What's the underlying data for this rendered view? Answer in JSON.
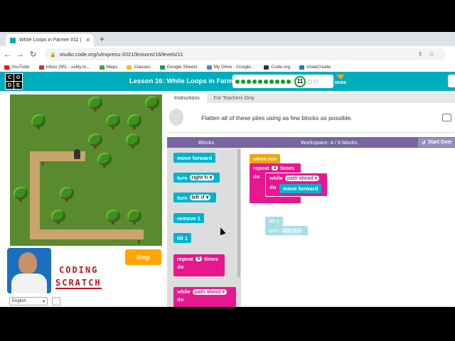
{
  "browser": {
    "tab_title": "While Loops in Farmer #11 |",
    "tab_close": "✕",
    "new_tab": "+",
    "url": "studio.code.org/s/express-2021/lessons/16/levels/11",
    "bookmarks": [
      {
        "label": "YouTube",
        "color": "#ff0000"
      },
      {
        "label": "Inbox (95) - sokly.to...",
        "color": "#d93025"
      },
      {
        "label": "Maps",
        "color": "#34a853"
      },
      {
        "label": "Classes",
        "color": "#fbbc04"
      },
      {
        "label": "Google Sheets",
        "color": "#0f9d58"
      },
      {
        "label": "My Drive - Google...",
        "color": "#4285f4"
      },
      {
        "label": "Code.org",
        "color": "#333333"
      },
      {
        "label": "VistaCreate",
        "color": "#1a73e8"
      }
    ]
  },
  "header": {
    "logo_letters": [
      "C",
      "O",
      "D",
      "E"
    ],
    "lesson_title": "Lesson 16: While Loops in Farmer",
    "current_level": "11",
    "completed_levels": 10,
    "remaining_levels": 2,
    "more_label": "MORE",
    "accent_color": "#00adbc"
  },
  "game": {
    "step_label": "Step"
  },
  "overlay": {
    "line1": "CODING",
    "line2": "SCRATCH"
  },
  "footer": {
    "language": "English"
  },
  "instructions": {
    "tabs": [
      "Instructions",
      "For Teachers Only"
    ],
    "text": "Flatten all of these piles using as few blocks as possible."
  },
  "blocks_panel": {
    "blocks_label": "Blocks",
    "workspace_label": "Workspace: 4 / 6 blocks",
    "start_over": "Start Over"
  },
  "toolbox": {
    "move_forward": "move forward",
    "turn": "turn",
    "right": "right ↻ ▾",
    "left": "left ↺ ▾",
    "remove": "remove 1",
    "fill": "fill 1",
    "repeat": "repeat",
    "repeat_count": "5",
    "times": "times",
    "do": "do",
    "while": "while",
    "path_ahead": "path ahead ▾"
  },
  "workspace": {
    "when_run": "when run",
    "repeat": "repeat",
    "repeat_count": "3",
    "times": "times",
    "do": "do",
    "while": "while",
    "path_ahead": "path ahead ▾",
    "move_forward": "move forward",
    "fill": "fill 1",
    "turn": "turn",
    "left": "left ↺ ▾"
  }
}
